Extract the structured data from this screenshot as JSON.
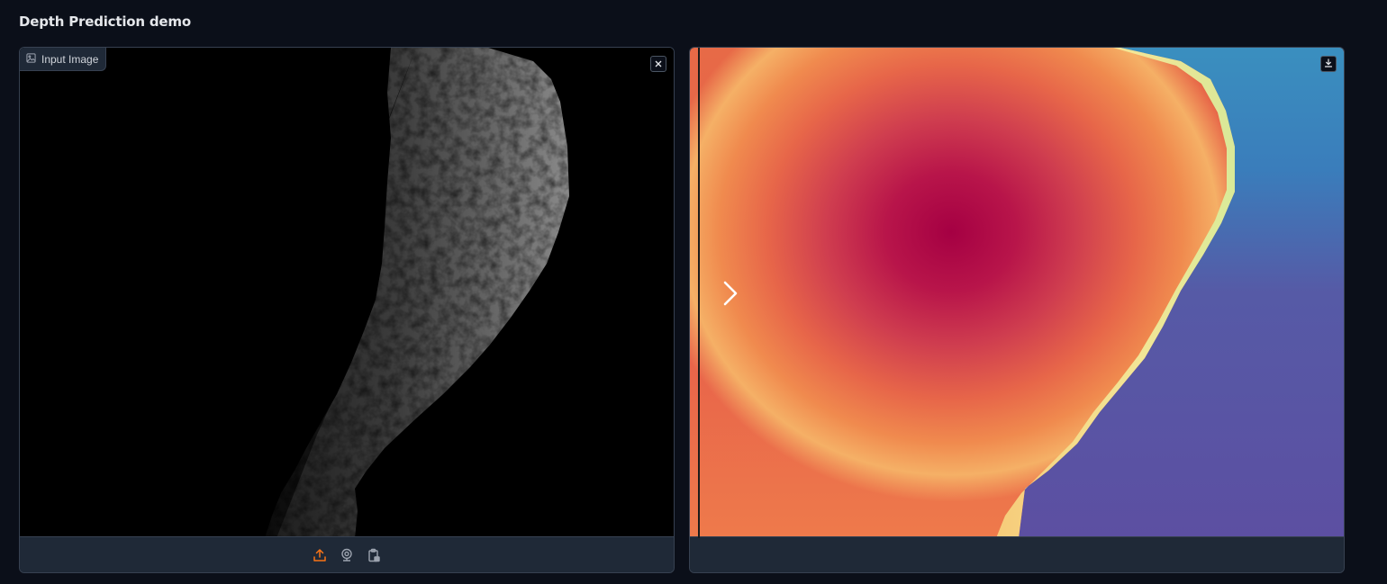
{
  "app": {
    "title": "Depth Prediction demo"
  },
  "input_panel": {
    "label": "Input Image",
    "label_icon": "image-icon",
    "clear_icon": "close-icon",
    "footer_icons": [
      "upload-icon",
      "webcam-icon",
      "clipboard-icon"
    ],
    "accent_color": "#f97316"
  },
  "output_panel": {
    "download_icon": "download-icon",
    "slider_handle_icon": "chevron-right-icon"
  },
  "colors": {
    "background": "#0b0f19",
    "panel": "#1f2937",
    "border": "#374151"
  }
}
